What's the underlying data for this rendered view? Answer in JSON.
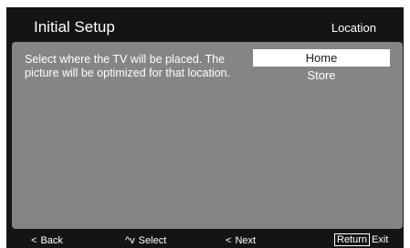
{
  "header": {
    "title": "Initial Setup",
    "section": "Location"
  },
  "main": {
    "description": "Select where the TV will be placed. The picture will be optimized for that location.",
    "options": [
      {
        "label": "Home",
        "selected": true
      },
      {
        "label": "Store",
        "selected": false
      }
    ]
  },
  "footer": {
    "back": {
      "symbol": "<",
      "label": "Back"
    },
    "select": {
      "symbol": "^v",
      "label": "Select"
    },
    "next": {
      "symbol": "<",
      "label": "Next"
    },
    "exit": {
      "key": "Return",
      "label": "Exit"
    }
  },
  "colors": {
    "background": "#141414",
    "panel": "#858585",
    "highlight": "#ffffff"
  }
}
